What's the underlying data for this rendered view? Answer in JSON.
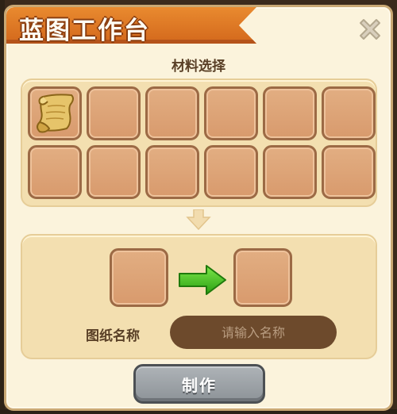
{
  "window": {
    "title": "蓝图工作台",
    "close_icon": "close-x-icon"
  },
  "materials": {
    "label": "材料选择",
    "slots": [
      {
        "item": "blueprint-scroll-icon"
      },
      {
        "item": ""
      },
      {
        "item": ""
      },
      {
        "item": ""
      },
      {
        "item": ""
      },
      {
        "item": ""
      },
      {
        "item": ""
      },
      {
        "item": ""
      },
      {
        "item": ""
      },
      {
        "item": ""
      },
      {
        "item": ""
      },
      {
        "item": ""
      }
    ]
  },
  "craft": {
    "name_label": "图纸名称",
    "name_placeholder": "请输入名称",
    "name_value": "",
    "make_button": "制作"
  },
  "colors": {
    "title_orange": "#e07a26",
    "panel_bg": "#fbf3dc",
    "slot_fill": "#dca274",
    "arrow_green": "#3cbf1c",
    "button_gray": "#9ea3a8",
    "input_brown": "#6d4a2c"
  }
}
